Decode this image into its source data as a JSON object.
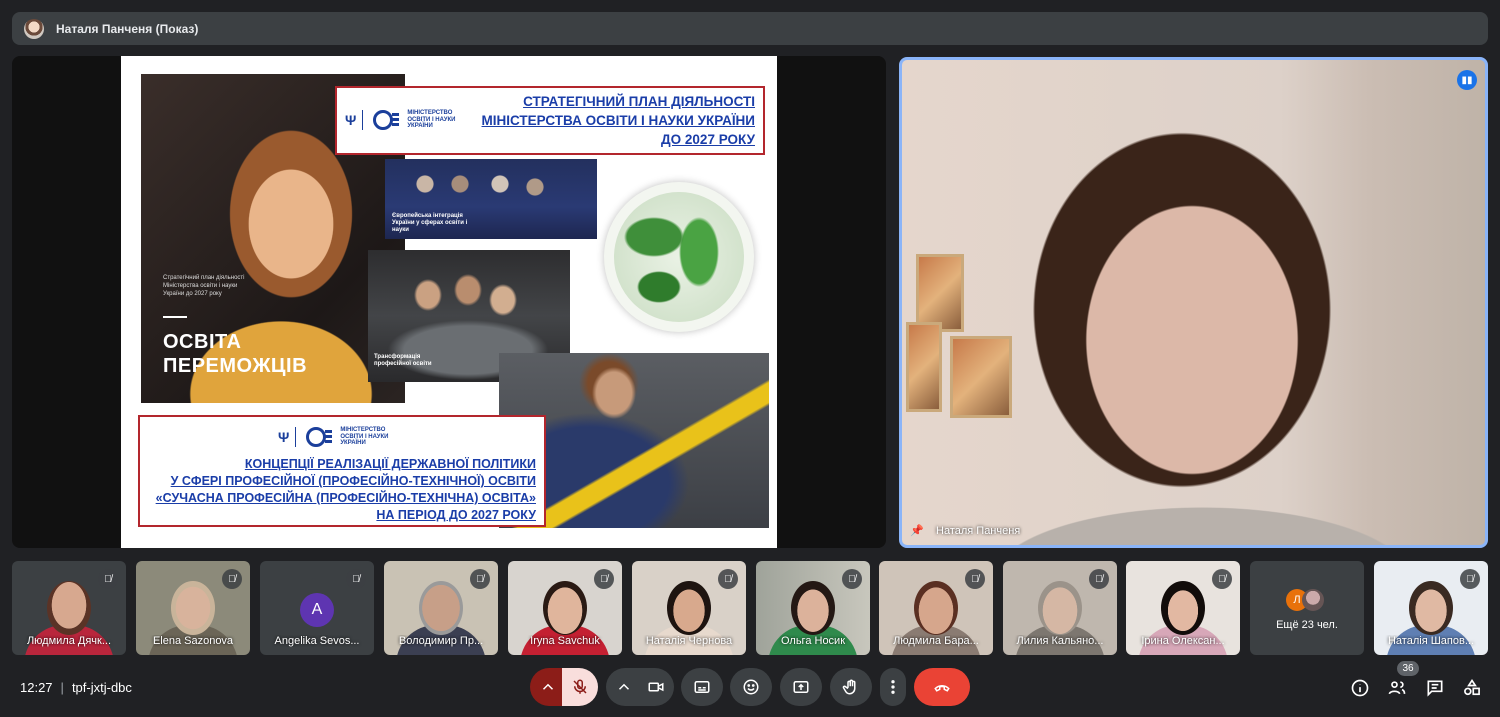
{
  "window": {
    "presenter_title": "Наталя Панченя (Показ)"
  },
  "slide": {
    "caption": "Стратегічний план діяльності Міністерства освіти і науки України до 2027 року",
    "headline_line1": "ОСВІТА",
    "headline_line2": "ПЕРЕМОЖЦІВ",
    "ministry_logo_text": "МІНІСТЕРСТВО ОСВІТИ І НАУКИ УКРАЇНИ",
    "photo1_text": "Європейська інтеграція України у сферах освіти і науки",
    "photo2_text": "Трансформація професійної освіти",
    "frame1_lines": [
      "СТРАТЕГІЧНИЙ ПЛАН ДІЯЛЬНОСТІ",
      "МІНІСТЕРСТВА ОСВІТИ І НАУКИ УКРАЇНИ",
      "ДО 2027 РОКУ"
    ],
    "frame2_lines": [
      "КОНЦЕПЦІЇ РЕАЛІЗАЦІЇ ДЕРЖАВНОЇ ПОЛІТИКИ",
      "У СФЕРІ ПРОФЕСІЙНОЇ (ПРОФЕСІЙНО-ТЕХНІЧНОЇ) ОСВІТИ",
      "«СУЧАСНА ПРОФЕСІЙНА (ПРОФЕСІЙНО-ТЕХНІЧНА) ОСВІТА»",
      "НА ПЕРІОД ДО 2027 РОКУ"
    ]
  },
  "speaker": {
    "name": "Наталя Панченя"
  },
  "participants": [
    {
      "name": "Людмила Дячк..."
    },
    {
      "name": "Elena Sazonova"
    },
    {
      "name": "Angelika Sevos...",
      "initial": "A"
    },
    {
      "name": "Володимир Пр..."
    },
    {
      "name": "Iryna Savchuk"
    },
    {
      "name": "Наталія Чернова"
    },
    {
      "name": "Ольга Носик"
    },
    {
      "name": "Людмила Бара..."
    },
    {
      "name": "Лилия Кальяно..."
    },
    {
      "name": "Ірина Олексан..."
    },
    {
      "name": "Наталія Шапов..."
    }
  ],
  "more_tile": {
    "initial": "Л",
    "text": "Ещё 23 чел."
  },
  "bottom_bar": {
    "time": "12:27",
    "separator": "|",
    "meeting_code": "tpf-jxtj-dbc",
    "people_count": "36"
  },
  "colors": {
    "accent": "#8ab4f8",
    "hangup": "#ea4335",
    "mic_off": "#f9dedc",
    "mic_group": "#8c1d18",
    "slide_frame": "#b3262d",
    "slide_text": "#1a3da8"
  }
}
